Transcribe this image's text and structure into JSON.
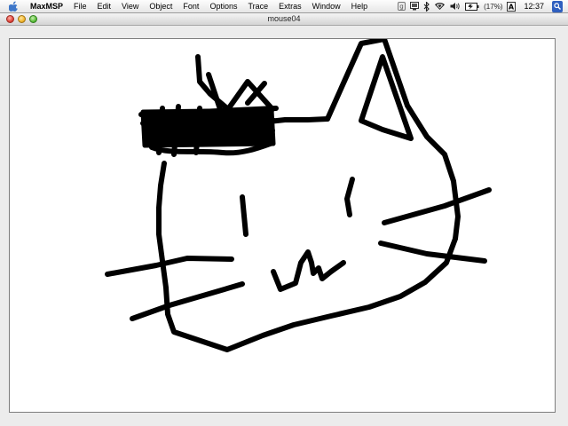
{
  "menubar": {
    "apple_icon": "apple-logo-icon",
    "items": [
      "MaxMSP",
      "File",
      "Edit",
      "View",
      "Object",
      "Font",
      "Options",
      "Trace",
      "Extras",
      "Window",
      "Help"
    ],
    "status": {
      "battery_percent": "(17%)",
      "clock": "12:37",
      "keyboard_layout": "A",
      "icons": [
        "growl-icon",
        "display-icon",
        "bluetooth-icon",
        "wifi-icon",
        "volume-icon",
        "battery-icon",
        "keyboard-icon",
        "spotlight-icon"
      ]
    }
  },
  "window": {
    "title": "mouse04",
    "controls": [
      "close",
      "minimize",
      "zoom"
    ]
  },
  "canvas": {
    "background": "#ffffff",
    "stroke_color": "#000000",
    "drawing": "cat-face-sketch"
  }
}
